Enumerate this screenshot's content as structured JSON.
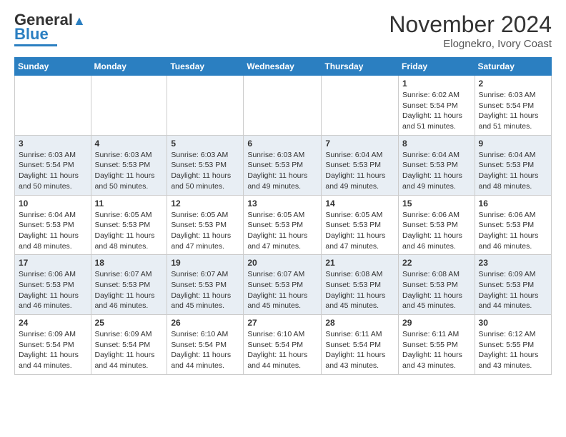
{
  "header": {
    "logo_line1": "General",
    "logo_line2": "Blue",
    "month": "November 2024",
    "location": "Elognekro, Ivory Coast"
  },
  "weekdays": [
    "Sunday",
    "Monday",
    "Tuesday",
    "Wednesday",
    "Thursday",
    "Friday",
    "Saturday"
  ],
  "weeks": [
    [
      {
        "day": "",
        "info": ""
      },
      {
        "day": "",
        "info": ""
      },
      {
        "day": "",
        "info": ""
      },
      {
        "day": "",
        "info": ""
      },
      {
        "day": "",
        "info": ""
      },
      {
        "day": "1",
        "info": "Sunrise: 6:02 AM\nSunset: 5:54 PM\nDaylight: 11 hours\nand 51 minutes."
      },
      {
        "day": "2",
        "info": "Sunrise: 6:03 AM\nSunset: 5:54 PM\nDaylight: 11 hours\nand 51 minutes."
      }
    ],
    [
      {
        "day": "3",
        "info": "Sunrise: 6:03 AM\nSunset: 5:54 PM\nDaylight: 11 hours\nand 50 minutes."
      },
      {
        "day": "4",
        "info": "Sunrise: 6:03 AM\nSunset: 5:53 PM\nDaylight: 11 hours\nand 50 minutes."
      },
      {
        "day": "5",
        "info": "Sunrise: 6:03 AM\nSunset: 5:53 PM\nDaylight: 11 hours\nand 50 minutes."
      },
      {
        "day": "6",
        "info": "Sunrise: 6:03 AM\nSunset: 5:53 PM\nDaylight: 11 hours\nand 49 minutes."
      },
      {
        "day": "7",
        "info": "Sunrise: 6:04 AM\nSunset: 5:53 PM\nDaylight: 11 hours\nand 49 minutes."
      },
      {
        "day": "8",
        "info": "Sunrise: 6:04 AM\nSunset: 5:53 PM\nDaylight: 11 hours\nand 49 minutes."
      },
      {
        "day": "9",
        "info": "Sunrise: 6:04 AM\nSunset: 5:53 PM\nDaylight: 11 hours\nand 48 minutes."
      }
    ],
    [
      {
        "day": "10",
        "info": "Sunrise: 6:04 AM\nSunset: 5:53 PM\nDaylight: 11 hours\nand 48 minutes."
      },
      {
        "day": "11",
        "info": "Sunrise: 6:05 AM\nSunset: 5:53 PM\nDaylight: 11 hours\nand 48 minutes."
      },
      {
        "day": "12",
        "info": "Sunrise: 6:05 AM\nSunset: 5:53 PM\nDaylight: 11 hours\nand 47 minutes."
      },
      {
        "day": "13",
        "info": "Sunrise: 6:05 AM\nSunset: 5:53 PM\nDaylight: 11 hours\nand 47 minutes."
      },
      {
        "day": "14",
        "info": "Sunrise: 6:05 AM\nSunset: 5:53 PM\nDaylight: 11 hours\nand 47 minutes."
      },
      {
        "day": "15",
        "info": "Sunrise: 6:06 AM\nSunset: 5:53 PM\nDaylight: 11 hours\nand 46 minutes."
      },
      {
        "day": "16",
        "info": "Sunrise: 6:06 AM\nSunset: 5:53 PM\nDaylight: 11 hours\nand 46 minutes."
      }
    ],
    [
      {
        "day": "17",
        "info": "Sunrise: 6:06 AM\nSunset: 5:53 PM\nDaylight: 11 hours\nand 46 minutes."
      },
      {
        "day": "18",
        "info": "Sunrise: 6:07 AM\nSunset: 5:53 PM\nDaylight: 11 hours\nand 46 minutes."
      },
      {
        "day": "19",
        "info": "Sunrise: 6:07 AM\nSunset: 5:53 PM\nDaylight: 11 hours\nand 45 minutes."
      },
      {
        "day": "20",
        "info": "Sunrise: 6:07 AM\nSunset: 5:53 PM\nDaylight: 11 hours\nand 45 minutes."
      },
      {
        "day": "21",
        "info": "Sunrise: 6:08 AM\nSunset: 5:53 PM\nDaylight: 11 hours\nand 45 minutes."
      },
      {
        "day": "22",
        "info": "Sunrise: 6:08 AM\nSunset: 5:53 PM\nDaylight: 11 hours\nand 45 minutes."
      },
      {
        "day": "23",
        "info": "Sunrise: 6:09 AM\nSunset: 5:53 PM\nDaylight: 11 hours\nand 44 minutes."
      }
    ],
    [
      {
        "day": "24",
        "info": "Sunrise: 6:09 AM\nSunset: 5:54 PM\nDaylight: 11 hours\nand 44 minutes."
      },
      {
        "day": "25",
        "info": "Sunrise: 6:09 AM\nSunset: 5:54 PM\nDaylight: 11 hours\nand 44 minutes."
      },
      {
        "day": "26",
        "info": "Sunrise: 6:10 AM\nSunset: 5:54 PM\nDaylight: 11 hours\nand 44 minutes."
      },
      {
        "day": "27",
        "info": "Sunrise: 6:10 AM\nSunset: 5:54 PM\nDaylight: 11 hours\nand 44 minutes."
      },
      {
        "day": "28",
        "info": "Sunrise: 6:11 AM\nSunset: 5:54 PM\nDaylight: 11 hours\nand 43 minutes."
      },
      {
        "day": "29",
        "info": "Sunrise: 6:11 AM\nSunset: 5:55 PM\nDaylight: 11 hours\nand 43 minutes."
      },
      {
        "day": "30",
        "info": "Sunrise: 6:12 AM\nSunset: 5:55 PM\nDaylight: 11 hours\nand 43 minutes."
      }
    ]
  ]
}
